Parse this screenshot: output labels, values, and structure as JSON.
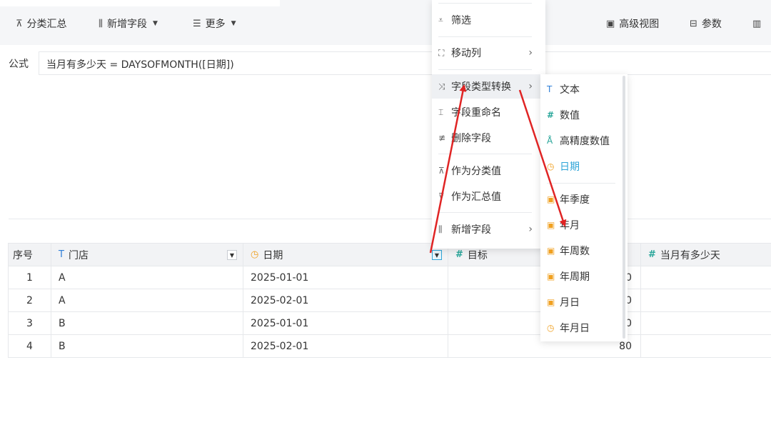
{
  "toolbar": {
    "group_summary": "分类汇总",
    "add_field": "新增字段",
    "more": "更多",
    "advanced_view": "高级视图",
    "params": "参数"
  },
  "formula": {
    "label": "公式",
    "value": "当月有多少天 = DAYSOFMONTH([日期])"
  },
  "table": {
    "columns": [
      "序号",
      "门店",
      "日期",
      "目标",
      "当月有多少天"
    ],
    "rows": [
      [
        "1",
        "A",
        "2025-01-01",
        "0",
        ""
      ],
      [
        "2",
        "A",
        "2025-02-01",
        "0",
        ""
      ],
      [
        "3",
        "B",
        "2025-01-01",
        "0",
        ""
      ],
      [
        "4",
        "B",
        "2025-02-01",
        "80",
        ""
      ]
    ]
  },
  "context_menu": {
    "items": [
      "筛选",
      "移动列",
      "字段类型转换",
      "字段重命名",
      "删除字段",
      "作为分类值",
      "作为汇总值",
      "新增字段"
    ]
  },
  "type_submenu": {
    "items": [
      "文本",
      "数值",
      "高精度数值",
      "日期",
      "年季度",
      "年月",
      "年周数",
      "年周期",
      "月日",
      "年月日"
    ],
    "selected": "日期"
  },
  "colors": {
    "accent": "#2fa5d8",
    "arrow": "#e02424",
    "date_icon": "#f0a020",
    "number_icon": "#29a69a",
    "text_icon": "#2f7fd8"
  }
}
